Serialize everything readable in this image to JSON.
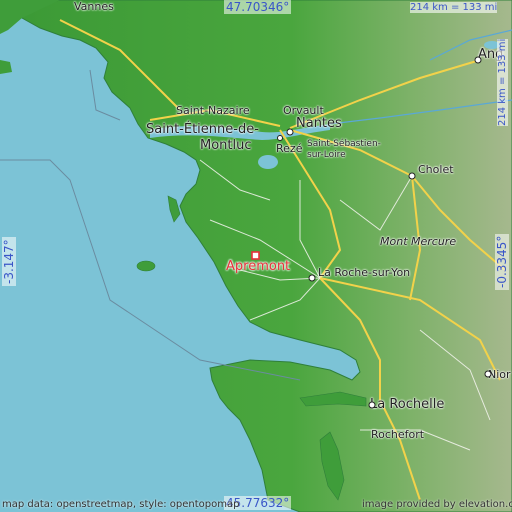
{
  "map": {
    "marker_label": "Apremont",
    "marker_color": "#e8303a",
    "sea_color": "#7cc3d6",
    "land_color": "#3f9d3a",
    "cities": {
      "vannes": "Vannes",
      "saint_nazaire": "Saint-Nazaire",
      "saint_etienne_1": "Saint-Étienne-de-",
      "saint_etienne_2": "Montluc",
      "orvault": "Orvault",
      "nantes": "Nantes",
      "reze": "Rezé",
      "saint_sebastien_1": "Saint-Sébastien-",
      "saint_sebastien_2": "sur-Loire",
      "cholet": "Cholet",
      "mont_mercure": "Mont Mercure",
      "la_roche": "La Roche-sur-Yon",
      "la_rochelle": "La Rochelle",
      "rochefort": "Rochefort",
      "niort": "Nior",
      "angers": "Ang"
    },
    "coords": {
      "top": "47.70346°",
      "bottom": "45.77632°",
      "left": "-3.147°",
      "right": "-0.3345°"
    },
    "scale": {
      "horizontal": "214 km = 133 mi",
      "vertical": "214 km = 133 mi"
    },
    "attribution_left": "map data: openstreetmap, style: opentopomap",
    "attribution_right": "image provided by elevation.city"
  }
}
